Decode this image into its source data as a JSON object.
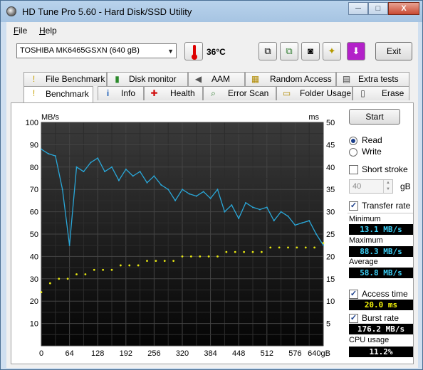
{
  "window": {
    "title": "HD Tune Pro 5.60 - Hard Disk/SSD Utility",
    "minimize": "─",
    "maximize": "□",
    "close": "X"
  },
  "menu": {
    "file": "File",
    "help": "Help"
  },
  "toolbar": {
    "drive": "TOSHIBA MK6465GSXN (640 gB)",
    "temperature": "36°C",
    "exit_label": "Exit"
  },
  "tabs_top": [
    {
      "label": "File Benchmark",
      "icon": "file-benchmark-icon",
      "glyph": "!"
    },
    {
      "label": "Disk monitor",
      "icon": "disk-monitor-icon",
      "glyph": "▮"
    },
    {
      "label": "AAM",
      "icon": "speaker-icon",
      "glyph": "◀"
    },
    {
      "label": "Random Access",
      "icon": "random-access-icon",
      "glyph": "▦"
    },
    {
      "label": "Extra tests",
      "icon": "extra-tests-icon",
      "glyph": "▤"
    }
  ],
  "tabs_bottom": [
    {
      "label": "Benchmark",
      "icon": "benchmark-icon",
      "glyph": "!"
    },
    {
      "label": "Info",
      "icon": "info-icon",
      "glyph": "i"
    },
    {
      "label": "Health",
      "icon": "health-cross-icon",
      "glyph": "✚"
    },
    {
      "label": "Error Scan",
      "icon": "magnifier-icon",
      "glyph": "⌕"
    },
    {
      "label": "Folder Usage",
      "icon": "folder-icon",
      "glyph": "▭"
    },
    {
      "label": "Erase",
      "icon": "trash-icon",
      "glyph": "▯"
    }
  ],
  "side": {
    "start_label": "Start",
    "read_label": "Read",
    "write_label": "Write",
    "short_stroke_label": "Short stroke",
    "stroke_value": "40",
    "stroke_unit": "gB",
    "transfer_rate_label": "Transfer rate",
    "minimum_label": "Minimum",
    "minimum_value": "13.1 MB/s",
    "maximum_label": "Maximum",
    "maximum_value": "88.3 MB/s",
    "average_label": "Average",
    "average_value": "58.8 MB/s",
    "access_time_label": "Access time",
    "access_time_value": "20.0 ms",
    "burst_rate_label": "Burst rate",
    "burst_rate_value": "176.2 MB/s",
    "cpu_label": "CPU usage",
    "cpu_value": "11.2%"
  },
  "colors": {
    "transfer_line": "#2aa7d8",
    "access_points": "#e6e612",
    "plot_bg": "#000000"
  },
  "chart_data": {
    "type": "line",
    "ylabel_left": "MB/s",
    "ylabel_right": "ms",
    "xlabel_unit": "gB",
    "x_ticks": [
      "0",
      "64",
      "128",
      "192",
      "256",
      "320",
      "384",
      "448",
      "512",
      "576",
      "640gB"
    ],
    "y_left_ticks": [
      "100",
      "90",
      "80",
      "70",
      "60",
      "50",
      "40",
      "30",
      "20",
      "10"
    ],
    "y_right_ticks": [
      "50",
      "45",
      "40",
      "35",
      "30",
      "25",
      "20",
      "15",
      "10",
      "5"
    ],
    "xlim": [
      0,
      640
    ],
    "ylim_left": [
      0,
      100
    ],
    "ylim_right": [
      0,
      50
    ],
    "grid": true,
    "series": [
      {
        "name": "Transfer rate",
        "x": [
          0,
          16,
          32,
          48,
          64,
          80,
          96,
          112,
          128,
          144,
          160,
          176,
          192,
          208,
          224,
          240,
          256,
          272,
          288,
          304,
          320,
          336,
          352,
          368,
          384,
          400,
          416,
          432,
          448,
          464,
          480,
          496,
          512,
          528,
          544,
          560,
          576,
          592,
          608,
          624,
          640
        ],
        "values": [
          88,
          86,
          85,
          70,
          45,
          80,
          78,
          82,
          84,
          78,
          80,
          74,
          79,
          76,
          78,
          73,
          76,
          72,
          70,
          65,
          70,
          68,
          67,
          69,
          66,
          70,
          60,
          63,
          57,
          64,
          62,
          61,
          62,
          56,
          60,
          58,
          54,
          55,
          56,
          50,
          45
        ]
      },
      {
        "name": "Access time",
        "x": [
          0,
          20,
          40,
          60,
          80,
          100,
          120,
          140,
          160,
          180,
          200,
          220,
          240,
          260,
          280,
          300,
          320,
          340,
          360,
          380,
          400,
          420,
          440,
          460,
          480,
          500,
          520,
          540,
          560,
          580,
          600,
          620,
          640
        ],
        "values": [
          12,
          14,
          15,
          15,
          16,
          16,
          17,
          17,
          17,
          18,
          18,
          18,
          19,
          19,
          19,
          19,
          20,
          20,
          20,
          20,
          20,
          21,
          21,
          21,
          21,
          21,
          22,
          22,
          22,
          22,
          22,
          22,
          23
        ]
      }
    ]
  }
}
